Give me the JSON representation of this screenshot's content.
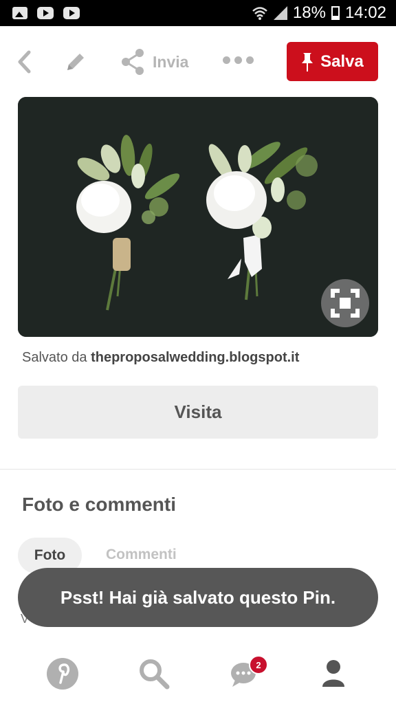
{
  "status_bar": {
    "battery": "18%",
    "time": "14:02",
    "icons": [
      "gallery-icon",
      "youtube-icon",
      "youtube-icon",
      "wifi-icon",
      "signal-icon",
      "battery-icon"
    ]
  },
  "toolbar": {
    "share_label": "Invia",
    "save_label": "Salva",
    "icons": [
      "back-icon",
      "edit-icon",
      "share-icon",
      "more-icon",
      "pin-icon"
    ],
    "save_color": "#cc0f1c"
  },
  "pin": {
    "saved_from_prefix": "Salvato da",
    "saved_from_source": "theproposalwedding.blogspot.it",
    "visit_label": "Visita"
  },
  "photos_comments": {
    "title": "Foto e commenti",
    "tabs": [
      "Foto",
      "Commenti"
    ],
    "active_tab": "Foto",
    "behind_toast_text": "V"
  },
  "toast": {
    "message": "Psst! Hai già salvato questo Pin."
  },
  "bottom_nav": {
    "items": [
      "pinterest-home-icon",
      "search-icon",
      "messages-icon",
      "profile-icon"
    ],
    "messages_badge": "2",
    "badge_color": "#c8102e"
  }
}
